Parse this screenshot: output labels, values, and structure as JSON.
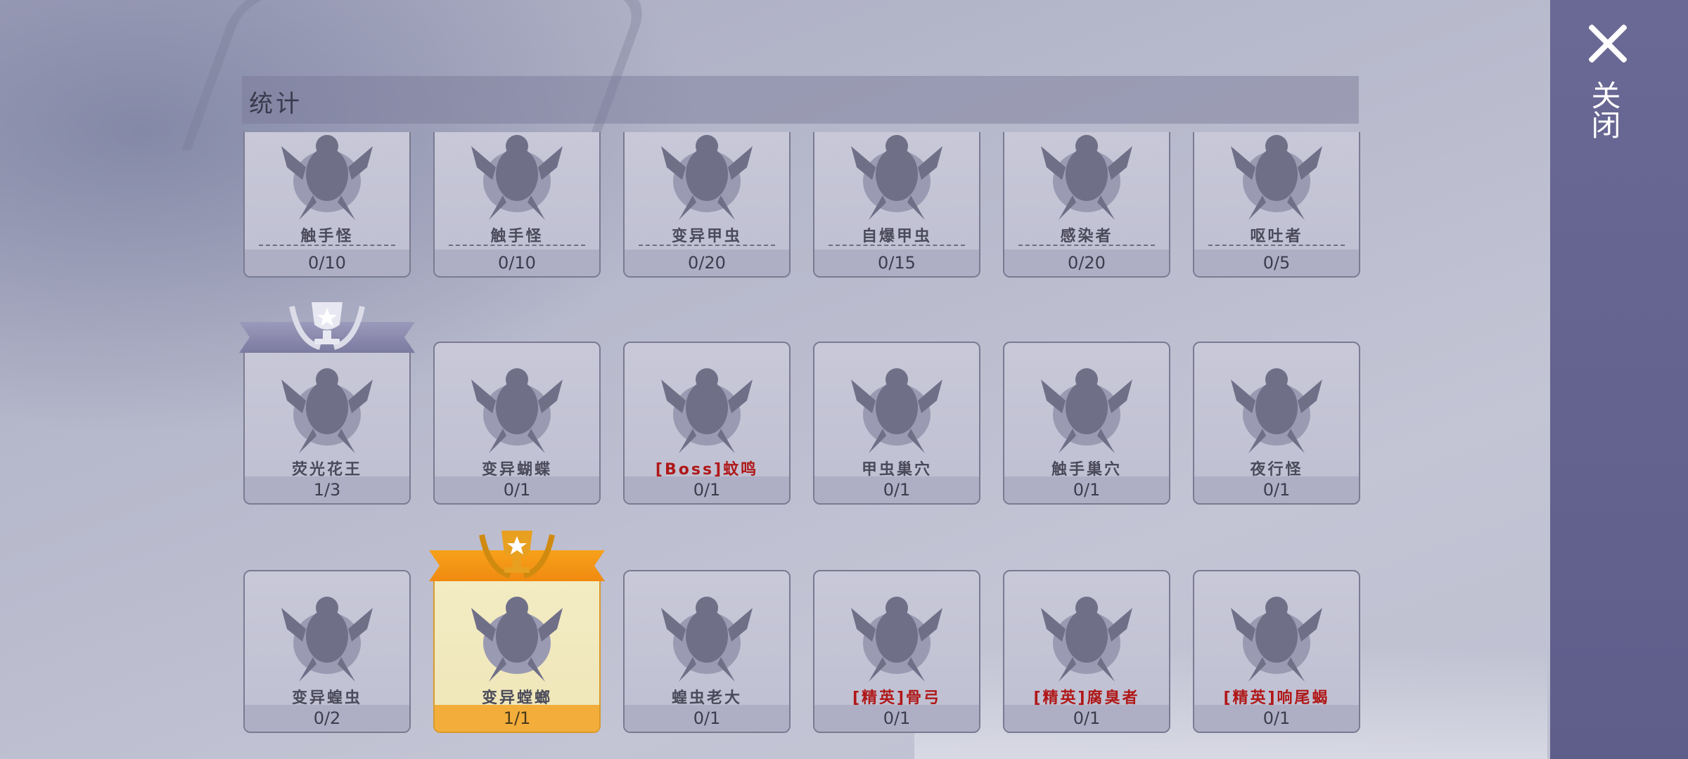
{
  "title": "统计",
  "close_label": "关闭",
  "colors": {
    "gold_ribbon": "#f5a01a",
    "silver_ribbon": "#8e8cb0",
    "elite_red": "#b01818"
  },
  "rows": [
    [
      {
        "name": "触手怪",
        "progress": "0/10",
        "red": false
      },
      {
        "name": "触手怪",
        "progress": "0/10",
        "red": false
      },
      {
        "name": "变异甲虫",
        "progress": "0/20",
        "red": false
      },
      {
        "name": "自爆甲虫",
        "progress": "0/15",
        "red": false
      },
      {
        "name": "感染者",
        "progress": "0/20",
        "red": false
      },
      {
        "name": "呕吐者",
        "progress": "0/5",
        "red": false
      }
    ],
    [
      {
        "name": "荧光花王",
        "progress": "1/3",
        "red": false,
        "badge": "silver"
      },
      {
        "name": "变异蝴蝶",
        "progress": "0/1",
        "red": false
      },
      {
        "name": "[Boss]蚊鸣",
        "progress": "0/1",
        "red": true
      },
      {
        "name": "甲虫巢穴",
        "progress": "0/1",
        "red": false
      },
      {
        "name": "触手巢穴",
        "progress": "0/1",
        "red": false
      },
      {
        "name": "夜行怪",
        "progress": "0/1",
        "red": false
      }
    ],
    [
      {
        "name": "变异蝗虫",
        "progress": "0/2",
        "red": false
      },
      {
        "name": "变异螳螂",
        "progress": "1/1",
        "red": false,
        "badge": "gold"
      },
      {
        "name": "蝗虫老大",
        "progress": "0/1",
        "red": false
      },
      {
        "name": "[精英]骨弓",
        "progress": "0/1",
        "red": true
      },
      {
        "name": "[精英]腐臭者",
        "progress": "0/1",
        "red": true
      },
      {
        "name": "[精英]响尾蝎",
        "progress": "0/1",
        "red": true
      }
    ]
  ]
}
